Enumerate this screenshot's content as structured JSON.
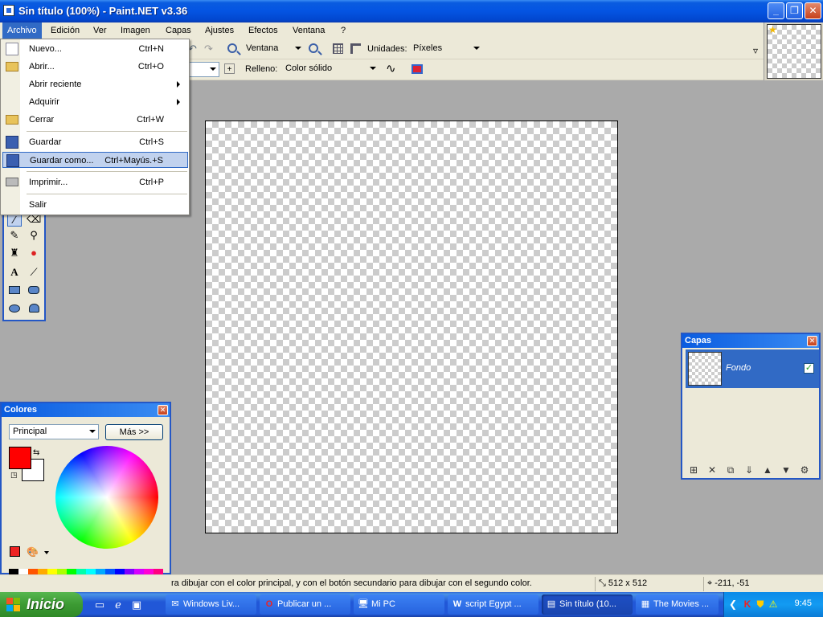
{
  "window": {
    "title": "Sin título (100%) - Paint.NET v3.36"
  },
  "menubar": {
    "items": [
      "Archivo",
      "Edición",
      "Ver",
      "Imagen",
      "Capas",
      "Ajustes",
      "Efectos",
      "Ventana",
      "?"
    ]
  },
  "toolbar": {
    "zoom_mode": "Ventana",
    "units_label": "Unidades:",
    "units_value": "Píxeles",
    "fill_label": "Relleno:",
    "fill_value": "Color sólido"
  },
  "file_menu": {
    "items": [
      {
        "label": "Nuevo...",
        "shortcut": "Ctrl+N"
      },
      {
        "label": "Abrir...",
        "shortcut": "Ctrl+O"
      },
      {
        "label": "Abrir reciente",
        "shortcut": ""
      },
      {
        "label": "Adquirir",
        "shortcut": ""
      },
      {
        "label": "Cerrar",
        "shortcut": "Ctrl+W"
      },
      {
        "label": "Guardar",
        "shortcut": "Ctrl+S"
      },
      {
        "label": "Guardar como...",
        "shortcut": "Ctrl+Mayús.+S"
      },
      {
        "label": "Imprimir...",
        "shortcut": "Ctrl+P"
      },
      {
        "label": "Salir",
        "shortcut": ""
      }
    ]
  },
  "colors_window": {
    "title": "Colores",
    "mode": "Principal",
    "more_button": "Más >>",
    "primary_color": "#ff0000",
    "secondary_color": "#ffffff"
  },
  "layers_window": {
    "title": "Capas",
    "layers": [
      {
        "name": "Fondo",
        "visible": true
      }
    ]
  },
  "statusbar": {
    "message": "ra dibujar con el color principal, y con el botón secundario para dibujar con el segundo color.",
    "image_size": "512 x 512",
    "cursor_position": "-211, -51"
  },
  "taskbar": {
    "start_label": "Inicio",
    "tasks": [
      {
        "label": "Windows Liv..."
      },
      {
        "label": "Publicar un ..."
      },
      {
        "label": "Mi PC"
      },
      {
        "label": "script Egypt ..."
      },
      {
        "label": "Sin título (10..."
      },
      {
        "label": "The Movies ..."
      }
    ],
    "clock": "9:45"
  }
}
